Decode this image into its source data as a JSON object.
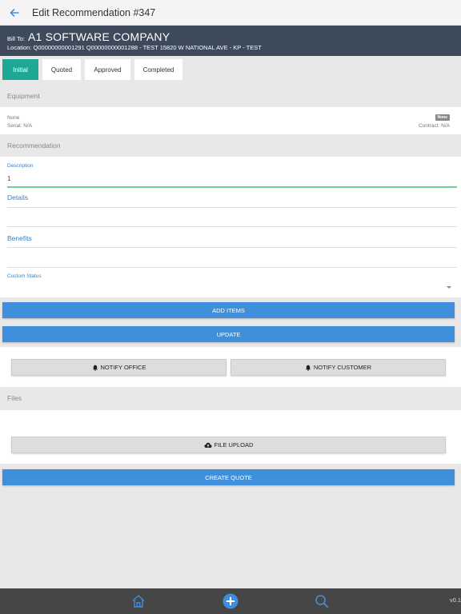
{
  "header": {
    "title": "Edit Recommendation #347"
  },
  "billto": {
    "label": "Bill To:",
    "company": "A1 SOFTWARE COMPANY",
    "location": "Location: Q00000000001291 Q00000000001288 - TEST 15820 W NATIONAL AVE - KP - TEST"
  },
  "tabs": [
    {
      "label": "Initial",
      "active": true
    },
    {
      "label": "Quoted",
      "active": false
    },
    {
      "label": "Approved",
      "active": false
    },
    {
      "label": "Completed",
      "active": false
    }
  ],
  "equipment": {
    "section_label": "Equipment",
    "name": "None",
    "badge": "None",
    "serial": "Serial: N/A",
    "contract": "Contract: N/A"
  },
  "recommendation": {
    "section_label": "Recommendation",
    "description_label": "Description",
    "description_value": "1",
    "details_label": "Details",
    "benefits_label": "Benefits",
    "custom_status_label": "Custom Status"
  },
  "buttons": {
    "add_items": "ADD ITEMS",
    "update": "UPDATE",
    "notify_office": "NOTIFY OFFICE",
    "notify_customer": "NOTIFY CUSTOMER",
    "file_upload": "FILE UPLOAD",
    "create_quote": "CREATE QUOTE"
  },
  "files": {
    "section_label": "Files"
  },
  "footer": {
    "version": "v0.1"
  },
  "colors": {
    "accent_teal": "#1fa796",
    "primary_blue": "#3f8fdc",
    "header_dark": "#3d4a5c",
    "link_blue": "#3a7fc2"
  },
  "icons": {
    "back": "arrow-left-icon",
    "bell": "bell-icon",
    "cloud_upload": "cloud-upload-icon",
    "home": "home-icon",
    "add": "plus-circle-icon",
    "search": "search-icon"
  }
}
